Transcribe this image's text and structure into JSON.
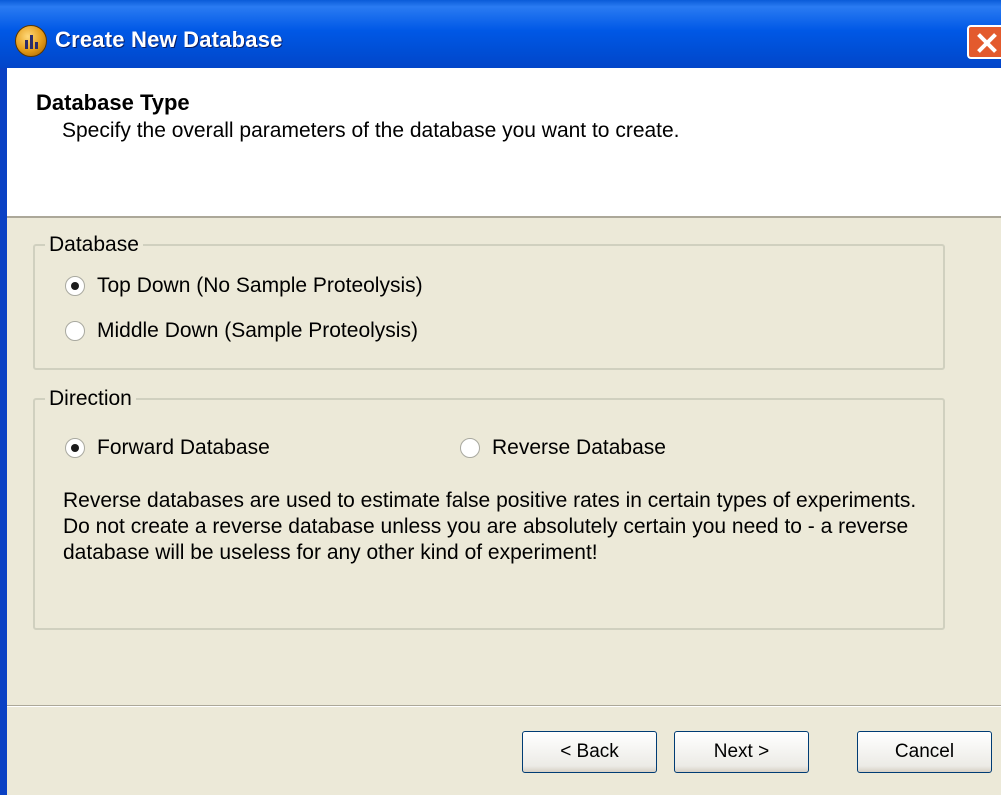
{
  "window": {
    "title": "Create New Database"
  },
  "header": {
    "title": "Database Type",
    "subtitle": "Specify the overall parameters of the database you want to create."
  },
  "database_group": {
    "label": "Database",
    "options": [
      {
        "label": "Top Down (No Sample Proteolysis)",
        "checked": true
      },
      {
        "label": "Middle Down (Sample Proteolysis)",
        "checked": false
      }
    ]
  },
  "direction_group": {
    "label": "Direction",
    "options": [
      {
        "label": "Forward Database",
        "checked": true
      },
      {
        "label": "Reverse Database",
        "checked": false
      }
    ],
    "info": "Reverse databases are used to estimate false positive rates in certain types of experiments.  Do not create a reverse database unless you are absolutely certain you need to - a reverse database will be useless for any other kind of experiment!"
  },
  "buttons": {
    "back": "< Back",
    "next": "Next >",
    "cancel": "Cancel"
  },
  "colors": {
    "titlebar": "#0058E6",
    "close": "#E35A2D",
    "dialog_bg": "#ECE9D8",
    "header_bg": "#FFFFFF"
  }
}
